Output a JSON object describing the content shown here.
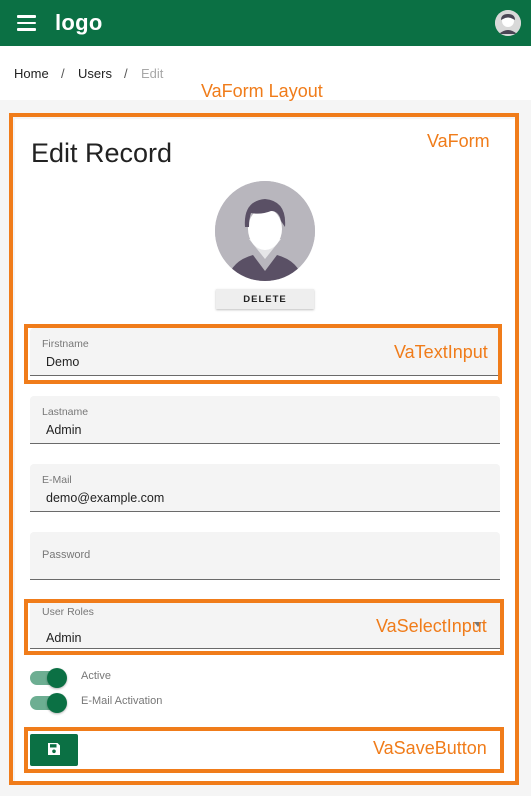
{
  "appbar": {
    "logo": "logo"
  },
  "breadcrumb": {
    "home": "Home",
    "users": "Users",
    "current": "Edit",
    "separator": "/"
  },
  "annotations": {
    "layout": "VaForm Layout",
    "form": "VaForm",
    "text_input": "VaTextInput",
    "select_input": "VaSelectInput",
    "save_button": "VaSaveButton"
  },
  "form": {
    "title": "Edit Record",
    "delete_label": "DELETE",
    "fields": {
      "firstname": {
        "label": "Firstname",
        "value": "Demo"
      },
      "lastname": {
        "label": "Lastname",
        "value": "Admin"
      },
      "email": {
        "label": "E-Mail",
        "value": "demo@example.com"
      },
      "password": {
        "label": "Password",
        "value": ""
      },
      "roles": {
        "label": "User Roles",
        "value": "Admin"
      }
    },
    "toggles": {
      "active": {
        "label": "Active",
        "on": true
      },
      "email_activation": {
        "label": "E-Mail Activation",
        "on": true
      }
    },
    "save_icon": "floppy-disk-icon"
  },
  "colors": {
    "primary": "#0b7044",
    "annotation": "#f07c1a",
    "toggle_track": "#6dae92"
  }
}
